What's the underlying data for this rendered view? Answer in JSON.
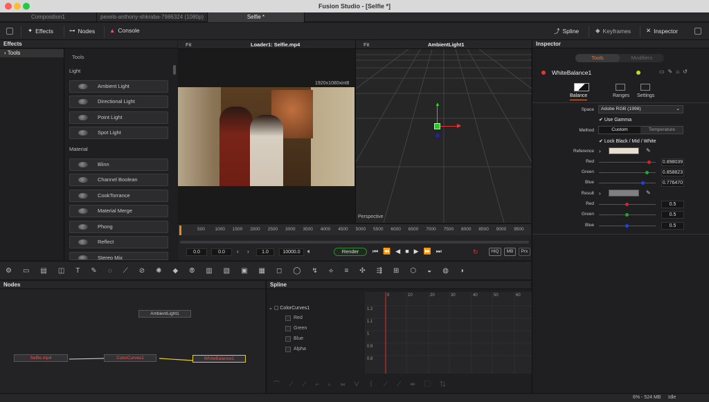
{
  "window": {
    "title": "Fusion Studio - [Selfie *]"
  },
  "tabs": [
    {
      "label": "Composition1"
    },
    {
      "label": "pexels-anthony-shkraba-7986324 (1080p)"
    },
    {
      "label": "Selfie *"
    }
  ],
  "toolbar": {
    "effects": "Effects",
    "nodes": "Nodes",
    "console": "Console",
    "spline": "Spline",
    "keyframes": "Keyframes",
    "inspector": "Inspector"
  },
  "effects_panel": {
    "title": "Effects",
    "tree_item": "Tools",
    "list_header": "Tools",
    "section_light": "Light",
    "section_material": "Material",
    "light_items": [
      "Ambient Light",
      "Directional Light",
      "Point Light",
      "Spot Light"
    ],
    "material_items": [
      "Blinn",
      "Channel Boolean",
      "CookTorrance",
      "Material Merge",
      "Phong",
      "Reflect",
      "Stereo Mix"
    ]
  },
  "viewer1": {
    "fit": "Fit",
    "source": "Loader1: Selfie.mp4",
    "resolution": "1920x1080xint8"
  },
  "viewer2": {
    "fit": "Fit",
    "source": "AmbientLight1",
    "label": "Perspective"
  },
  "timeline": {
    "ticks": [
      "500",
      "1000",
      "1500",
      "2000",
      "2500",
      "3000",
      "3500",
      "4000",
      "4500",
      "5000",
      "5500",
      "6000",
      "6500",
      "7000",
      "7500",
      "8000",
      "8500",
      "9000",
      "9500"
    ],
    "start": "0.0",
    "current": "0.0",
    "step": "1.0",
    "end": "10000.0",
    "render": "Render",
    "hiq": "HiQ",
    "mb": "MB",
    "prx": "Prx"
  },
  "nodes_panel": {
    "title": "Nodes",
    "nodes": [
      "AmbientLight1",
      "Selfie.mp4",
      "ColorCurves1",
      "WhiteBalance1"
    ]
  },
  "spline_panel": {
    "title": "Spline",
    "root": "ColorCurves1",
    "channels": [
      "Red",
      "Green",
      "Blue",
      "Alpha"
    ],
    "y_ticks": [
      "1.2",
      "1.1",
      "1",
      "0.9",
      "0.8"
    ],
    "x_ticks": [
      "0",
      "10",
      "20",
      "30",
      "40",
      "50",
      "60"
    ]
  },
  "inspector": {
    "title": "Inspector",
    "tab_tools": "Tools",
    "tab_modifiers": "Modifiers",
    "node_name": "WhiteBalance1",
    "subtabs": [
      "Balance",
      "Ranges",
      "Settings"
    ],
    "space_label": "Space",
    "space_value": "Adobe RGB (1998)",
    "use_gamma": "Use Gamma",
    "method_label": "Method",
    "method_custom": "Custom",
    "method_temperature": "Temperature",
    "lock_label": "Lock Black / Mid / White",
    "reference_label": "Reference",
    "ref_red_label": "Red",
    "ref_red": "0.898039",
    "ref_green_label": "Green",
    "ref_green": "0.858823",
    "ref_blue_label": "Blue",
    "ref_blue": "0.776470",
    "result_label": "Result",
    "res_red_label": "Red",
    "res_red": "0.5",
    "res_green_label": "Green",
    "res_green": "0.5",
    "res_blue_label": "Blue",
    "res_blue": "0.5",
    "colors": {
      "reference": "#e8dfd0",
      "result": "#808080"
    }
  },
  "status": {
    "memory": "6% - 524 MB",
    "state": "Idle"
  }
}
